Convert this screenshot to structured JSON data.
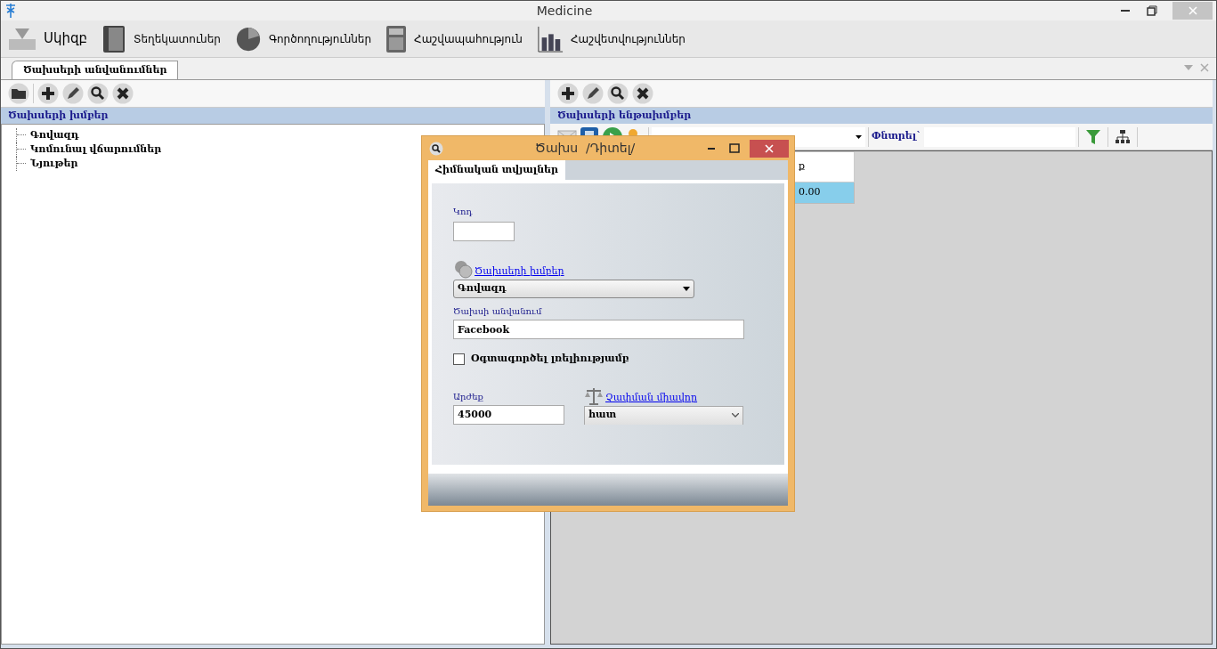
{
  "window": {
    "title": "Medicine"
  },
  "toolbar": [
    {
      "label": "Սկիզբ",
      "kind": "tray"
    },
    {
      "label": "Տեղեկատուներ",
      "kind": "book"
    },
    {
      "label": "Գործողություններ",
      "kind": "pie"
    },
    {
      "label": "Հաշվապահություն",
      "kind": "calculator"
    },
    {
      "label": "Հաշվետվություններ",
      "kind": "bars"
    }
  ],
  "document_tabs": [
    {
      "label": "Ծախսերի անվանումներ",
      "selected": true
    }
  ],
  "left_panel": {
    "title": "Ծախսերի խմբեր",
    "tree": [
      {
        "label": "Գովազդ"
      },
      {
        "label": "Կոմունալ վճարումներ"
      },
      {
        "label": "Նյութեր"
      }
    ]
  },
  "right_panel": {
    "title": "Ծախսերի ենթախմբեր",
    "search_label": "Փնտրել`",
    "table": {
      "columns": [
        "ք"
      ],
      "rows": [
        {
          "cells": [
            "0.00"
          ],
          "selected": true
        }
      ]
    }
  },
  "dialog": {
    "title": "Ծախս  /Դիտել/",
    "tabs": [
      {
        "label": "Հիմնական տվյալներ",
        "selected": true
      }
    ],
    "code_label": "Կոդ",
    "group_link": "Ծախսերի խմբեր",
    "group_value": "Գովազդ",
    "name_label": "Ծախսի անվանում",
    "name_value": "Facebook",
    "default_checkbox": {
      "label": "Օգտագործել լռելիությամբ",
      "checked": false
    },
    "value_label": "Արժեք",
    "value": "45000",
    "unit_link": "Չափման միավոր",
    "unit_value": "հատ"
  }
}
